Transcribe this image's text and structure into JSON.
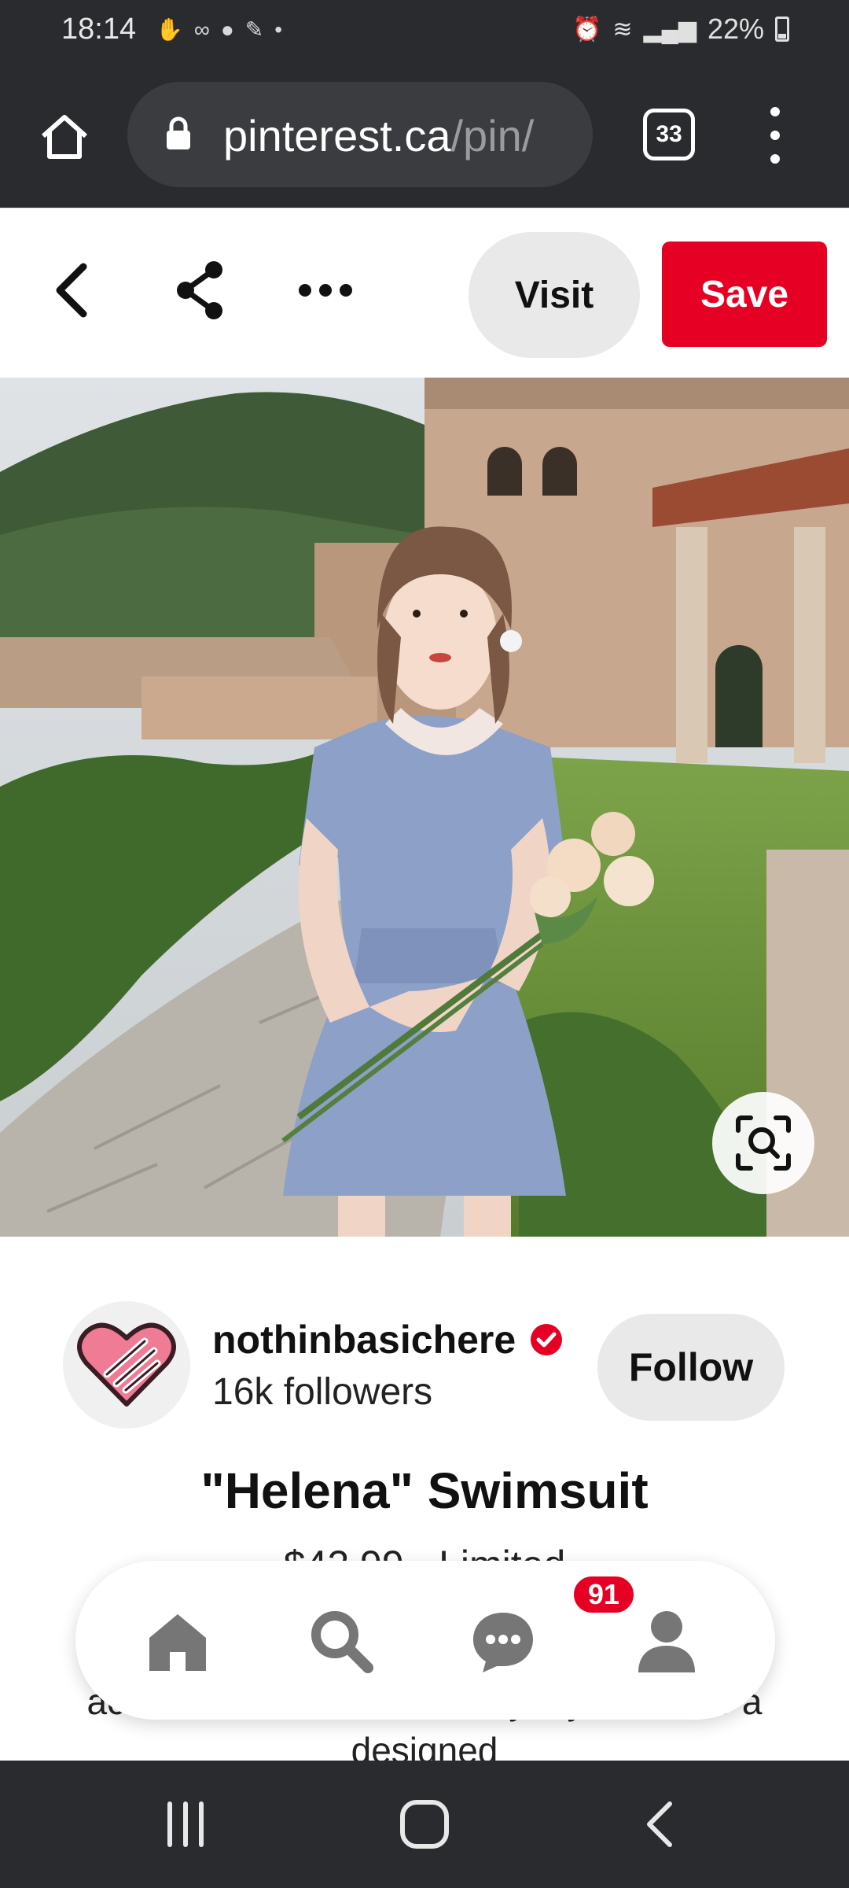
{
  "status_bar": {
    "time": "18:14",
    "battery": "22%"
  },
  "browser": {
    "url_host": "pinterest.ca",
    "url_path": "/pin/",
    "tab_count": "33"
  },
  "pin_header": {
    "visit_label": "Visit",
    "save_label": "Save"
  },
  "creator": {
    "name": "nothinbasichere",
    "followers": "16k followers",
    "follow_label": "Follow"
  },
  "pin": {
    "title": "\"Helena\" Swimsuit",
    "price_partial": "$42.99 · Limited",
    "description": "ac… …uit will turn an everyday item into a designed"
  },
  "bottom_nav": {
    "items": [
      "home-icon",
      "search-icon",
      "messages-icon",
      "profile-icon"
    ],
    "messages_badge": "91"
  },
  "colors": {
    "brand_red": "#e60023",
    "chrome_dark": "#2a2b2e"
  }
}
